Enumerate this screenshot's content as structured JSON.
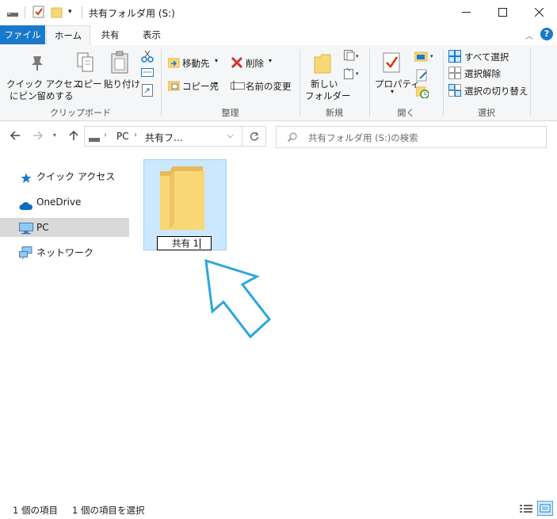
{
  "window": {
    "title": "共有フォルダ用 (S:)"
  },
  "ribbon_tabs": [
    "ファイル",
    "ホーム",
    "共有",
    "表示"
  ],
  "clipboard": {
    "pin_label": "クイック アクセス\nにピン留めする",
    "pin_label_1": "クイック アクセス",
    "pin_label_2": "にピン留めする",
    "copy": "コピー",
    "paste": "貼り付け",
    "group": "クリップボード"
  },
  "organize": {
    "move_to": "移動先",
    "copy_to": "コピー先",
    "delete": "削除",
    "rename": "名前の変更",
    "group": "整理"
  },
  "new": {
    "new_folder_1": "新しい",
    "new_folder_2": "フォルダー",
    "group": "新規"
  },
  "open": {
    "properties": "プロパティ",
    "group": "開く"
  },
  "select": {
    "select_all": "すべて選択",
    "select_none": "選択解除",
    "invert": "選択の切り替え",
    "group": "選択"
  },
  "address": {
    "crumb_pc": "PC",
    "crumb_current": "共有フ...",
    "search_placeholder": "共有フォルダ用 (S:)の検索"
  },
  "nav": {
    "quick_access": "クイック アクセス",
    "onedrive": "OneDrive",
    "pc": "PC",
    "network": "ネットワーク"
  },
  "content": {
    "rename_value": "共有 1"
  },
  "status": {
    "count": "1 個の項目",
    "selected": "1 個の項目を選択"
  },
  "colors": {
    "accent": "#1979ca",
    "selection": "#cce8ff",
    "arrow": "#2aa7dd"
  }
}
